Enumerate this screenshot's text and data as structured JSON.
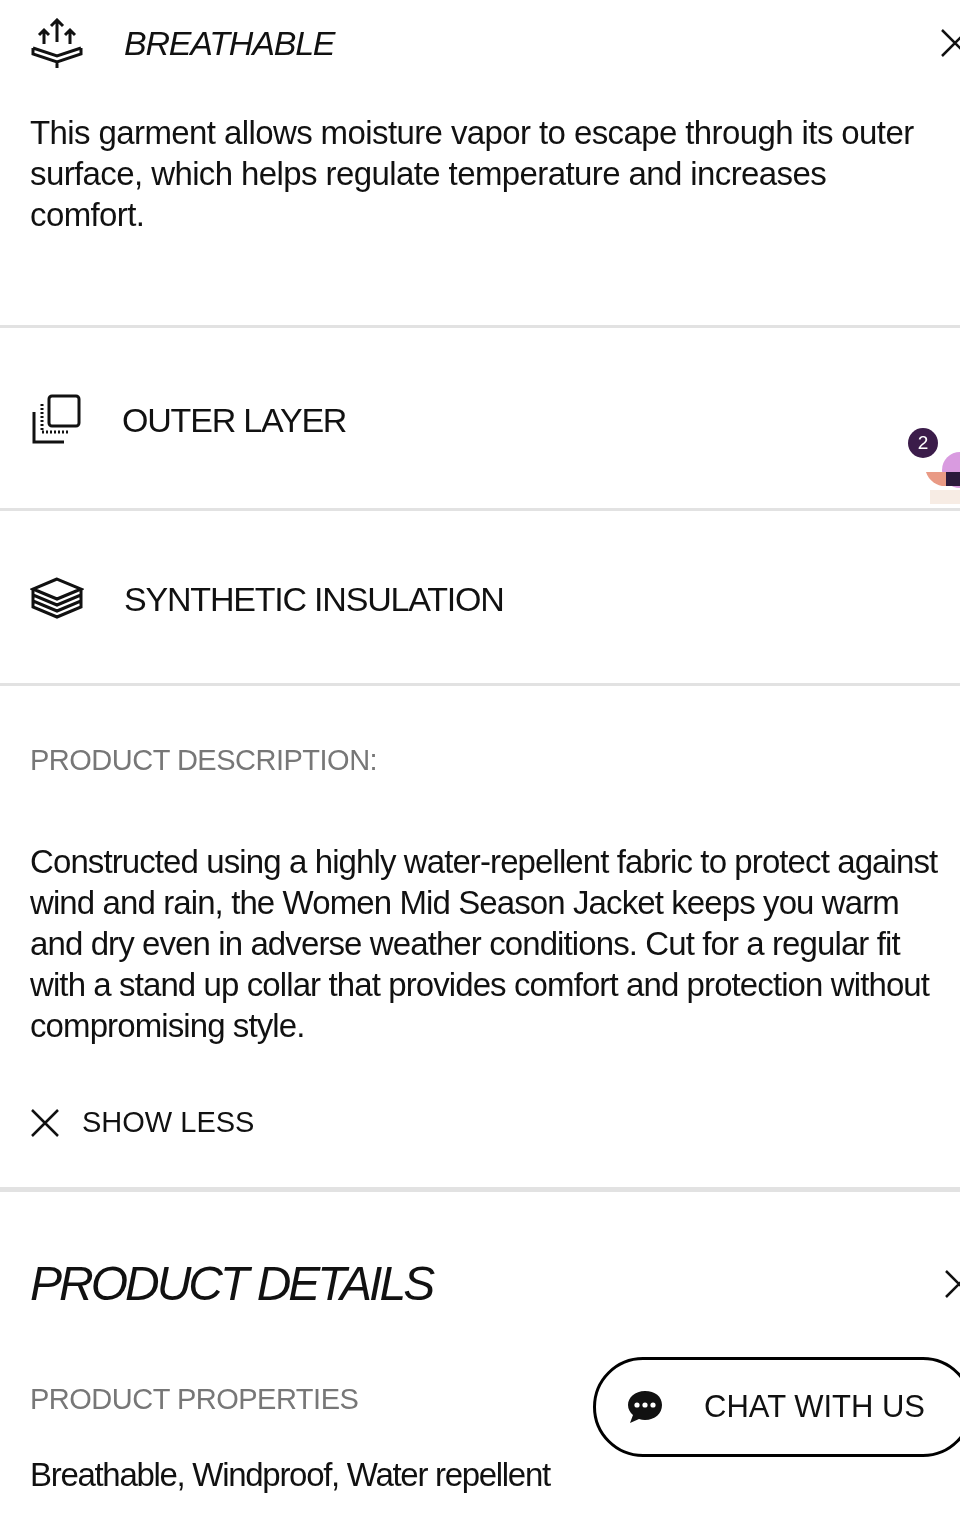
{
  "features": [
    {
      "kind": "breathable",
      "title": "BREATHABLE",
      "expanded": true,
      "description": "This garment allows moisture vapor to escape through its outer surface, which helps regulate temperature and increases comfort."
    },
    {
      "kind": "layer",
      "title": "OUTER LAYER",
      "expanded": false
    },
    {
      "kind": "insulation",
      "title": "SYNTHETIC INSULATION",
      "expanded": false
    }
  ],
  "product_description": {
    "label": "PRODUCT DESCRIPTION:",
    "text": "Constructed using a highly water-repellent fabric to protect against wind and rain, the Women Mid Season Jacket keeps you warm and dry even in adverse weather conditions. Cut for a regular fit with a stand up collar that provides comfort and protection without compromising style.",
    "toggle": "SHOW LESS"
  },
  "product_details": {
    "title": "PRODUCT DETAILS",
    "expanded": true,
    "label": "PRODUCT PROPERTIES",
    "value": "Breathable, Windproof, Water repellent"
  },
  "notification_badge": "2",
  "chat_button": "CHAT WITH US"
}
